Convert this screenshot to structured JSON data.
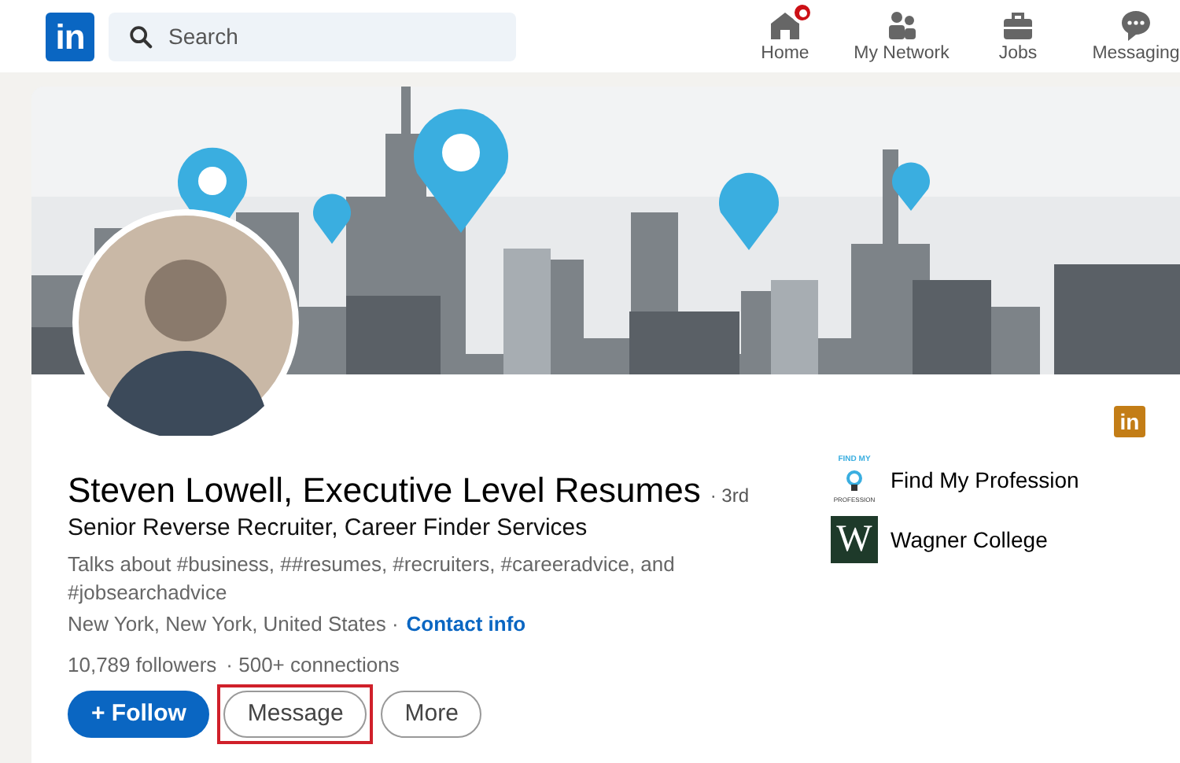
{
  "nav": {
    "logo": "in",
    "search": {
      "placeholder": "Search"
    },
    "items": [
      {
        "label": "Home",
        "kind": "home",
        "badge": true
      },
      {
        "label": "My Network",
        "kind": "network",
        "badge": false
      },
      {
        "label": "Jobs",
        "kind": "jobs",
        "badge": false
      },
      {
        "label": "Messaging",
        "kind": "messaging",
        "badge": false
      }
    ]
  },
  "profile": {
    "premium_badge": "in",
    "name": "Steven Lowell, Executive Level Resumes",
    "degree": "· 3rd",
    "headline": "Senior Reverse Recruiter, Career Finder Services",
    "talks_about": "Talks about #business, ##resumes, #recruiters, #careeradvice, and #jobsearchadvice",
    "location": "New York, New York, United States ·",
    "contact_link": "Contact info",
    "followers": "10,789 followers",
    "connections": "· 500+ connections",
    "actions": [
      {
        "label": "+ Follow",
        "kind": "primary",
        "highlighted": false
      },
      {
        "label": "Message",
        "kind": "secondary",
        "highlighted": true
      },
      {
        "label": "More",
        "kind": "secondary",
        "highlighted": false
      }
    ],
    "organizations": [
      {
        "name": "Find My Profession",
        "kind": "bulb",
        "logo_text": [
          "FIND MY",
          "PROFESSION"
        ]
      },
      {
        "name": "Wagner College",
        "kind": "letter",
        "logo_text": [
          "W"
        ]
      }
    ]
  }
}
